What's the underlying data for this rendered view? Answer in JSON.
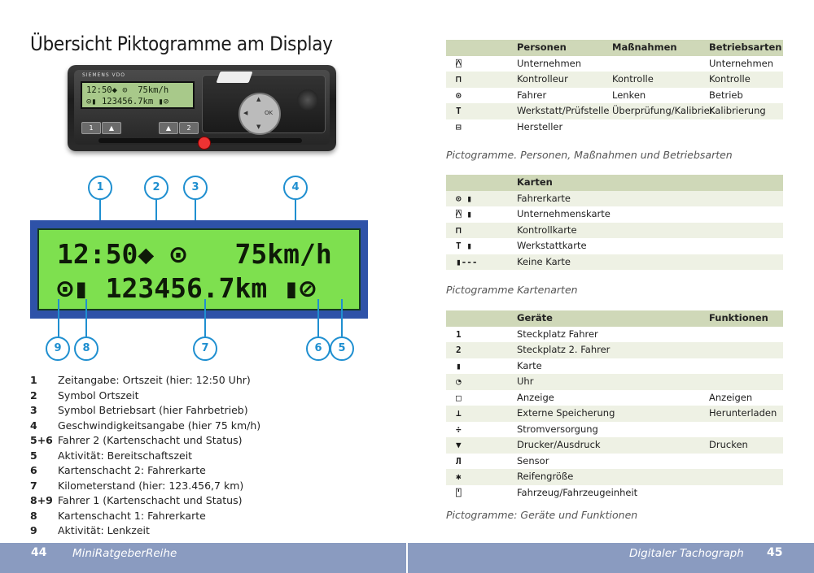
{
  "page_title": "Übersicht Piktogramme am Display",
  "device": {
    "brand": "SIEMENS VDO",
    "lcd_line1": "12:50◆ ⊙  75km/h",
    "lcd_line2": "⊙▮ 123456.7km ▮⊘",
    "btn1": "1",
    "btn2": "2",
    "nav_ok": "OK"
  },
  "lcd": {
    "line1": "12:50◆ ⊙   75km/h",
    "line2": "⊙▮ 123456.7km ▮⊘"
  },
  "callouts": [
    "1",
    "2",
    "3",
    "4",
    "5",
    "6",
    "7",
    "8",
    "9"
  ],
  "legend": [
    {
      "num": "1",
      "text": "Zeitangabe: Ortszeit (hier: 12:50 Uhr)"
    },
    {
      "num": "2",
      "text": "Symbol Ortszeit"
    },
    {
      "num": "3",
      "text": "Symbol Betriebsart (hier Fahrbetrieb)"
    },
    {
      "num": "4",
      "text": "Geschwindigkeitsangabe (hier 75 km/h)"
    },
    {
      "num": "5+6",
      "text": "Fahrer 2 (Kartenschacht und Status)"
    },
    {
      "num": "5",
      "text": "Aktivität: Bereitschaftszeit"
    },
    {
      "num": "6",
      "text": "Kartenschacht 2: Fahrerkarte"
    },
    {
      "num": "7",
      "text": "Kilometerstand (hier: 123.456,7 km)"
    },
    {
      "num": "8+9",
      "text": "Fahrer 1 (Kartenschacht und Status)"
    },
    {
      "num": "8",
      "text": "Kartenschacht 1: Fahrerkarte"
    },
    {
      "num": "9",
      "text": "Aktivität: Lenkzeit"
    }
  ],
  "table1": {
    "headers": [
      "Personen",
      "Maßnahmen",
      "Betriebsarten"
    ],
    "rows": [
      {
        "icon": "⍓",
        "a": "Unternehmen",
        "b": "",
        "c": "Unternehmen"
      },
      {
        "icon": "⊓",
        "a": "Kontrolleur",
        "b": "Kontrolle",
        "c": "Kontrolle"
      },
      {
        "icon": "⊙",
        "a": "Fahrer",
        "b": "Lenken",
        "c": "Betrieb"
      },
      {
        "icon": "T",
        "a": "Werkstatt/Prüfstelle",
        "b": "Überprüfung/Kalibrier.",
        "c": "Kalibrierung"
      },
      {
        "icon": "⊟",
        "a": "Hersteller",
        "b": "",
        "c": ""
      }
    ],
    "caption": "Pictogramme. Personen, Maßnahmen und Betriebsarten"
  },
  "table2": {
    "headers": [
      "Karten"
    ],
    "rows": [
      {
        "icon": "⊙ ▮",
        "a": "Fahrerkarte"
      },
      {
        "icon": "⍓ ▮",
        "a": "Unternehmenskarte"
      },
      {
        "icon": "⊓",
        "a": "Kontrollkarte"
      },
      {
        "icon": "T ▮",
        "a": "Werkstattkarte"
      },
      {
        "icon": "▮---",
        "a": "Keine Karte"
      }
    ],
    "caption": "Pictogramme Kartenarten"
  },
  "table3": {
    "headers": [
      "Geräte",
      "Funktionen"
    ],
    "rows": [
      {
        "icon": "1",
        "a": "Steckplatz Fahrer",
        "c": ""
      },
      {
        "icon": "2",
        "a": "Steckplatz 2. Fahrer",
        "c": ""
      },
      {
        "icon": "▮",
        "a": "Karte",
        "c": ""
      },
      {
        "icon": "◔",
        "a": "Uhr",
        "c": ""
      },
      {
        "icon": "□",
        "a": "Anzeige",
        "c": "Anzeigen"
      },
      {
        "icon": "⊥",
        "a": "Externe Speicherung",
        "c": "Herunterladen"
      },
      {
        "icon": "÷",
        "a": "Stromversorgung",
        "c": ""
      },
      {
        "icon": "▼",
        "a": "Drucker/Ausdruck",
        "c": "Drucken"
      },
      {
        "icon": "Л",
        "a": "Sensor",
        "c": ""
      },
      {
        "icon": "✱",
        "a": "Reifengröße",
        "c": ""
      },
      {
        "icon": "⍞",
        "a": "Fahrzeug/Fahrzeugeinheit",
        "c": ""
      }
    ],
    "caption": "Pictogramme: Geräte und Funktionen"
  },
  "footer": {
    "left_page_num": "44",
    "left_title": "MiniRatgeberReihe",
    "right_title": "Digitaler Tachograph",
    "right_page_num": "45"
  }
}
